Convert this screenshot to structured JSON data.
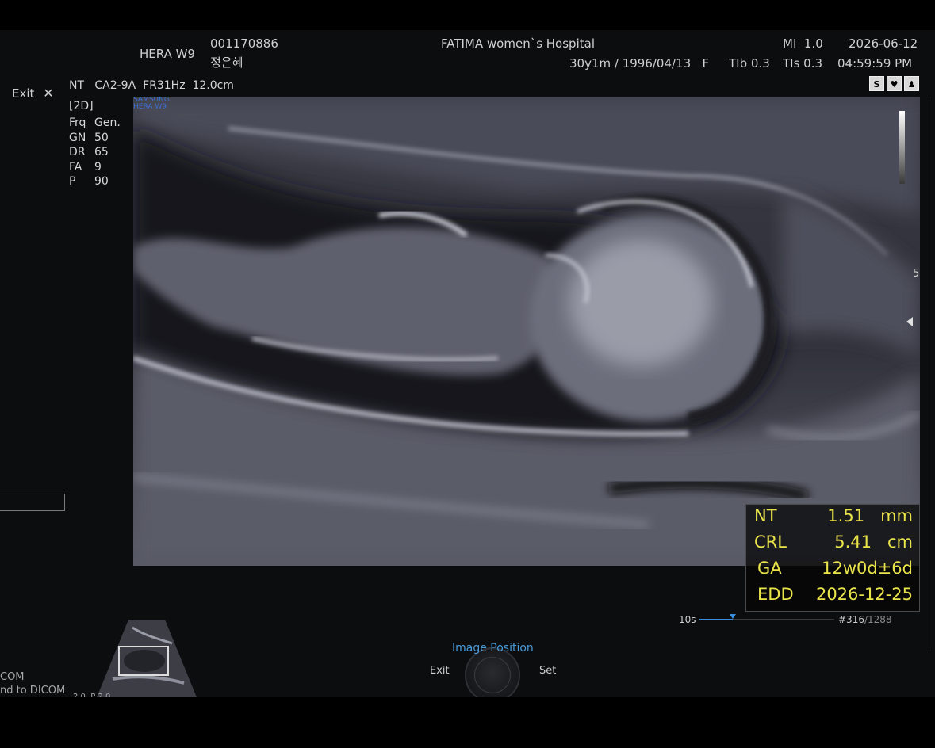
{
  "header": {
    "model": "HERA W9",
    "patient_id": "001170886",
    "patient_name": "정은혜",
    "hospital": "FATIMA women`s Hospital",
    "patient_info": "30y1m / 1996/04/13   F",
    "mi": "MI  1.0",
    "tib": "TIb 0.3",
    "tis": "TIs 0.3",
    "date": "2026-06-12",
    "time": "04:59:59 PM"
  },
  "probe_line": "NT   CA2-9A  FR31Hz  12.0cm",
  "mode": "[2D]",
  "params": [
    {
      "k": "Frq",
      "v": "Gen."
    },
    {
      "k": "GN",
      "v": "50"
    },
    {
      "k": "DR",
      "v": "65"
    },
    {
      "k": "FA",
      "v": "9"
    },
    {
      "k": "P",
      "v": "90"
    }
  ],
  "brand_watermark": {
    "line1": "SAMSUNG",
    "line2": "HERA W9"
  },
  "exit_top_label": "Exit",
  "right_icons": [
    "S",
    "♥",
    "♟"
  ],
  "scale_marker": "5",
  "measurements": [
    {
      "label": "NT",
      "value": "1.51   mm"
    },
    {
      "label": "CRL",
      "value": "5.41   cm"
    },
    {
      "label": "GA",
      "value": "12w0d±6d"
    },
    {
      "label": "EDD",
      "value": "2026-12-25"
    }
  ],
  "cine": {
    "duration": "10s",
    "frame": "#316",
    "total": "/1288",
    "position": 0.245
  },
  "knob": {
    "title": "Image Position",
    "left": "Exit",
    "right": "Set"
  },
  "bottom_left": {
    "line1": "COM",
    "line2": "nd to DICOM",
    "line3": "2 0  P 2 0"
  },
  "colors": {
    "measure_text": "#e9e44a",
    "accent": "#4a9ad8",
    "cine": "#3a8ee0"
  },
  "icons": [
    "close-icon",
    "settings-icon",
    "heart-icon",
    "person-icon",
    "cine-cursor-icon",
    "depth-pointer-icon"
  ]
}
